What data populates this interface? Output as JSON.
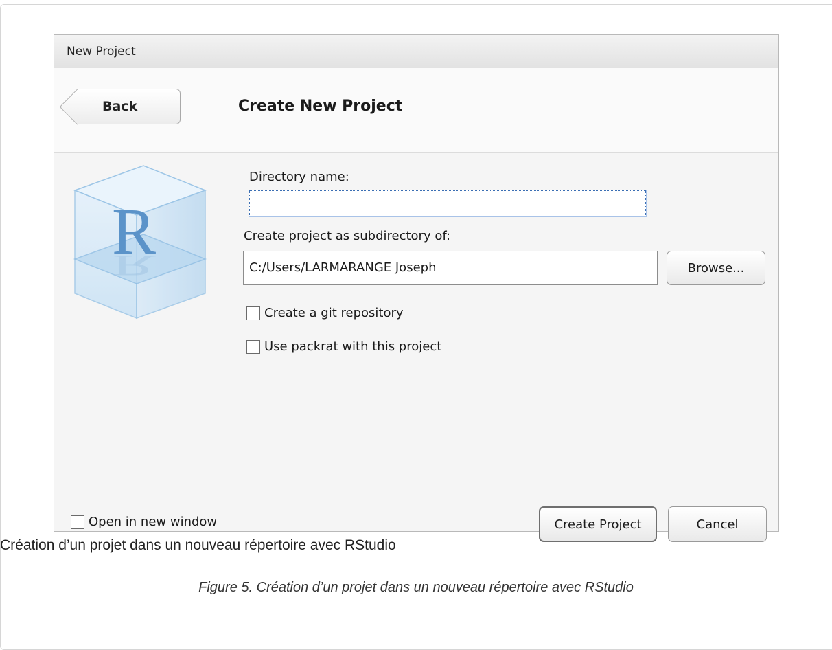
{
  "dialog": {
    "title": "New Project",
    "back_label": "Back",
    "header_title": "Create New Project",
    "logo_letter": "R",
    "directory_name_label": "Directory name:",
    "directory_name_value": "",
    "subdirectory_label": "Create project as subdirectory of:",
    "subdirectory_value": "C:/Users/LARMARANGE Joseph",
    "browse_label": "Browse...",
    "git_checkbox_label": "Create a git repository",
    "git_checked": false,
    "packrat_checkbox_label": "Use packrat with this project",
    "packrat_checked": false,
    "open_new_window_label": "Open in new window",
    "open_new_window_checked": false,
    "create_project_label": "Create Project",
    "cancel_label": "Cancel"
  },
  "page": {
    "caption": "Création d’un projet dans un nouveau répertoire avec RStudio",
    "figure_caption": "Figure 5. Création d’un projet dans un nouveau répertoire avec RStudio"
  },
  "colors": {
    "dialog_bg": "#f5f5f5",
    "titlebar_bg": "#e8e8e8",
    "logo_blue": "#5b93c9"
  }
}
